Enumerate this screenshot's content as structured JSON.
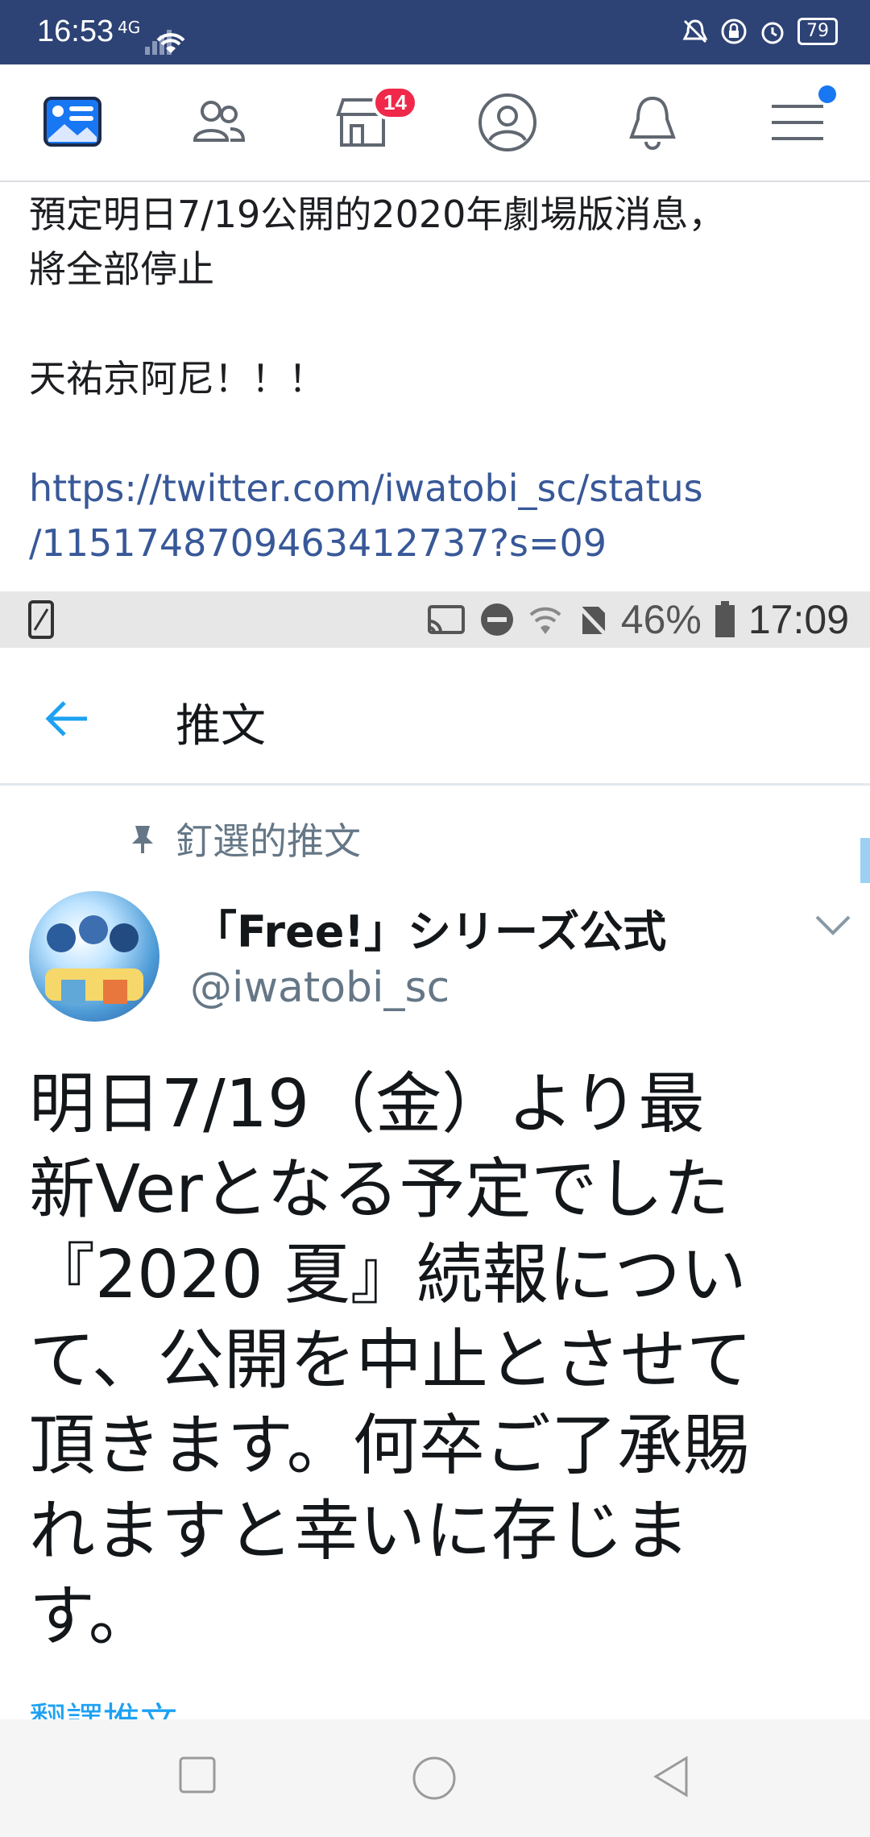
{
  "fb_status_bar": {
    "time": "16:53",
    "signal": "4G",
    "battery": "79"
  },
  "fb_nav": {
    "tabs": [
      "news-feed",
      "friends",
      "marketplace",
      "profile",
      "notifications",
      "menu"
    ],
    "marketplace_badge": "14",
    "accent": "#1877f2"
  },
  "post": {
    "line1": "預定明日7/19公開的2020年劇場版消息，",
    "line2": "將全部停止",
    "line3": "天祐京阿尼！！！",
    "link_line1": "https://twitter.com/iwatobi_sc/status",
    "link_line2": "/1151748709463412737?s=09"
  },
  "inner_status_bar": {
    "battery_percent": "46%",
    "time": "17:09"
  },
  "twitter": {
    "header_title": "推文",
    "pinned_label": "釘選的推文",
    "author_name": "「Free!」シリーズ公式",
    "author_handle": "@iwatobi_sc",
    "tweet_lines": [
      "明日7/19（金）より最",
      "新Verとなる予定でした",
      "『2020 夏』続報につい",
      "て、公開を中止とさせて",
      "頂きます。何卒ご了承賜",
      "れますと幸いに存じま",
      "す。"
    ],
    "translate_label": "翻譯推文",
    "accent": "#1da1f2"
  }
}
